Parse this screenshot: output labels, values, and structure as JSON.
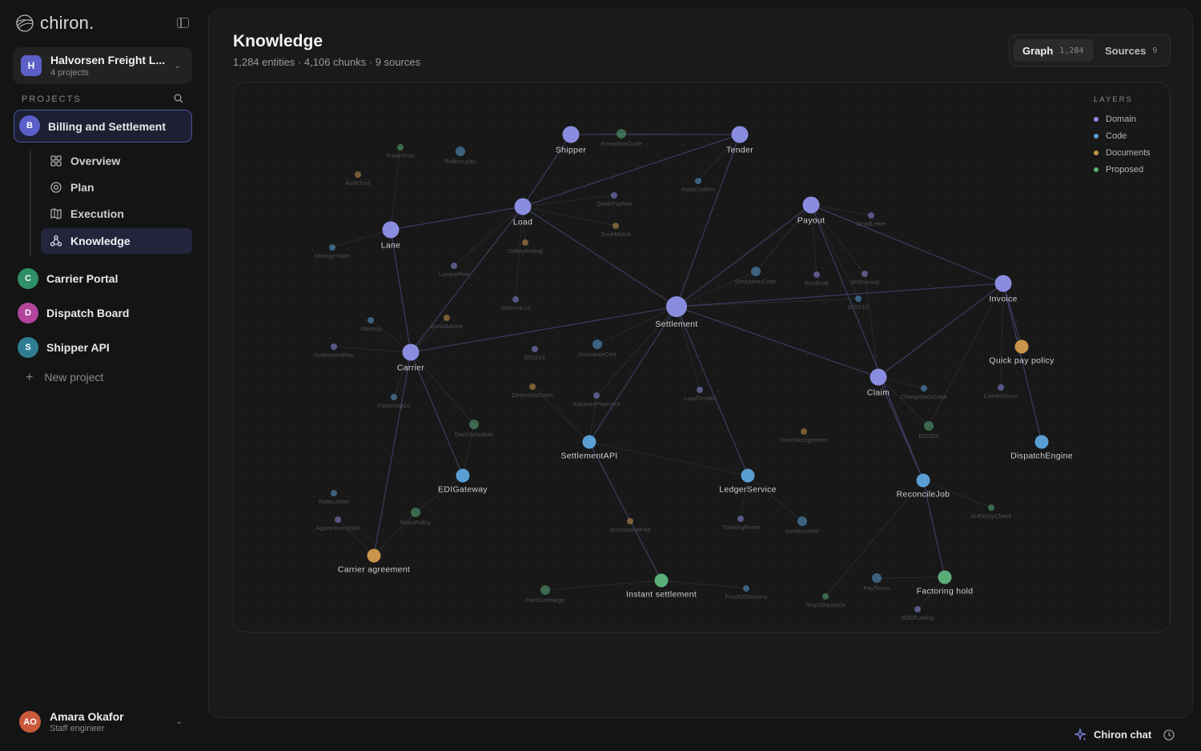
{
  "app": {
    "name": "chiron."
  },
  "workspace": {
    "avatar": "H",
    "name": "Halvorsen Freight L...",
    "sub": "4 projects"
  },
  "projects": {
    "label": "PROJECTS",
    "active": {
      "avatar": "B",
      "name": "Billing and Settlement"
    },
    "nav": [
      {
        "label": "Overview",
        "icon": "grid-icon"
      },
      {
        "label": "Plan",
        "icon": "target-icon"
      },
      {
        "label": "Execution",
        "icon": "map-icon"
      },
      {
        "label": "Knowledge",
        "icon": "graph-icon"
      }
    ],
    "others": [
      {
        "avatar": "C",
        "name": "Carrier Portal",
        "color": "#2f8f67"
      },
      {
        "avatar": "D",
        "name": "Dispatch Board",
        "color": "#b0459b"
      },
      {
        "avatar": "S",
        "name": "Shipper API",
        "color": "#2f7d93"
      }
    ],
    "new_label": "New project"
  },
  "user": {
    "initials": "AO",
    "name": "Amara Okafor",
    "role": "Staff engineer"
  },
  "header": {
    "title": "Knowledge",
    "subtitle": "1,284 entities · 4,106 chunks · 9 sources"
  },
  "tabs": [
    {
      "label": "Graph",
      "count": "1,284"
    },
    {
      "label": "Sources",
      "count": "9"
    }
  ],
  "legend": {
    "title": "LAYERS",
    "items": [
      {
        "label": "Domain",
        "color": "#8a8ddf"
      },
      {
        "label": "Code",
        "color": "#5a9fd4"
      },
      {
        "label": "Documents",
        "color": "#c9954a"
      },
      {
        "label": "Proposed",
        "color": "#5aac78"
      }
    ]
  },
  "graph": {
    "nodes": [
      {
        "label": "Shipper",
        "layer": "Domain",
        "major": true
      },
      {
        "label": "Tender",
        "layer": "Domain",
        "major": true
      },
      {
        "label": "Load",
        "layer": "Domain",
        "major": true
      },
      {
        "label": "Lane",
        "layer": "Domain",
        "major": true
      },
      {
        "label": "Payout",
        "layer": "Domain",
        "major": true
      },
      {
        "label": "Settlement",
        "layer": "Domain",
        "major": true
      },
      {
        "label": "Invoice",
        "layer": "Domain",
        "major": true
      },
      {
        "label": "Carrier",
        "layer": "Domain",
        "major": true
      },
      {
        "label": "Claim",
        "layer": "Domain",
        "major": true
      },
      {
        "label": "Quick pay policy",
        "layer": "Documents",
        "major": true
      },
      {
        "label": "SettlementAPI",
        "layer": "Code",
        "major": true
      },
      {
        "label": "DispatchEngine",
        "layer": "Code",
        "major": true
      },
      {
        "label": "EDIGateway",
        "layer": "Code",
        "major": true
      },
      {
        "label": "LedgerService",
        "layer": "Code",
        "major": true
      },
      {
        "label": "ReconcileJob",
        "layer": "Code",
        "major": true
      },
      {
        "label": "Carrier agreement",
        "layer": "Documents",
        "major": true
      },
      {
        "label": "Instant settlement",
        "layer": "Proposed",
        "major": true
      },
      {
        "label": "Factoring hold",
        "layer": "Proposed",
        "major": true
      },
      {
        "label": "ExceptionCode",
        "layer": "Proposed",
        "major": false
      },
      {
        "label": "TrailerPool",
        "layer": "Proposed",
        "major": false
      },
      {
        "label": "Rollout plan",
        "layer": "Code",
        "major": false
      },
      {
        "label": "AuditTrail",
        "layer": "Documents",
        "major": false
      },
      {
        "label": "RateConfirm",
        "layer": "Code",
        "major": false
      },
      {
        "label": "QuickPayFee",
        "layer": "Domain",
        "major": false
      },
      {
        "label": "ZoneMatrix",
        "layer": "Documents",
        "major": false
      },
      {
        "label": "DeadLetter",
        "layer": "Domain",
        "major": false
      },
      {
        "label": "SafetyRating",
        "layer": "Documents",
        "major": false
      },
      {
        "label": "MileageTable",
        "layer": "Code",
        "major": false
      },
      {
        "label": "LumperFee",
        "layer": "Domain",
        "major": false
      },
      {
        "label": "DeductionCode",
        "layer": "Code",
        "major": false
      },
      {
        "label": "Runbook",
        "layer": "Domain",
        "major": false
      },
      {
        "label": "W9Record",
        "layer": "Domain",
        "major": false
      },
      {
        "label": "EDI210",
        "layer": "Code",
        "major": false
      },
      {
        "label": "Schema v2",
        "layer": "Domain",
        "major": false
      },
      {
        "label": "Alerting",
        "layer": "Code",
        "major": false
      },
      {
        "label": "BondAdvice",
        "layer": "Documents",
        "major": false
      },
      {
        "label": "SettlementRun",
        "layer": "Domain",
        "major": false
      },
      {
        "label": "EDI214",
        "layer": "Domain",
        "major": false
      },
      {
        "label": "InsuranceCert",
        "layer": "Code",
        "major": false
      },
      {
        "label": "DetentionClaim",
        "layer": "Documents",
        "major": false
      },
      {
        "label": "AdvancePayment",
        "layer": "Domain",
        "major": false
      },
      {
        "label": "LoadTender",
        "layer": "Domain",
        "major": false
      },
      {
        "label": "ChargebackCase",
        "layer": "Code",
        "major": false
      },
      {
        "label": "CarrierScore",
        "layer": "Domain",
        "major": false
      },
      {
        "label": "FactoringCo",
        "layer": "Code",
        "major": false
      },
      {
        "label": "DockSchedule",
        "layer": "Proposed",
        "major": false
      },
      {
        "label": "DriverAssignment",
        "layer": "Documents",
        "major": false
      },
      {
        "label": "EDI204",
        "layer": "Proposed",
        "major": false
      },
      {
        "label": "RateLimiter",
        "layer": "Code",
        "major": false
      },
      {
        "label": "RetryPolicy",
        "layer": "Proposed",
        "major": false
      },
      {
        "label": "AppointmentSlot",
        "layer": "Domain",
        "major": false
      },
      {
        "label": "AccessorialFee",
        "layer": "Documents",
        "major": false
      },
      {
        "label": "TrackingEvent",
        "layer": "Domain",
        "major": false
      },
      {
        "label": "GeofenceHit",
        "layer": "Code",
        "major": false
      },
      {
        "label": "AuthorityCheck",
        "layer": "Proposed",
        "major": false
      },
      {
        "label": "FuelSurcharge",
        "layer": "Proposed",
        "major": false
      },
      {
        "label": "ProofOfDelivery",
        "layer": "Code",
        "major": false
      },
      {
        "label": "PayTerms",
        "layer": "Code",
        "major": false
      },
      {
        "label": "StopSequence",
        "layer": "Proposed",
        "major": false
      },
      {
        "label": "BillOfLading",
        "layer": "Domain",
        "major": false
      }
    ],
    "edges": [
      [
        "Shipper",
        "Tender"
      ],
      [
        "Shipper",
        "Load"
      ],
      [
        "Tender",
        "Load"
      ],
      [
        "Tender",
        "Settlement"
      ],
      [
        "Load",
        "Lane"
      ],
      [
        "Load",
        "Settlement"
      ],
      [
        "Load",
        "Carrier"
      ],
      [
        "Lane",
        "Carrier"
      ],
      [
        "Payout",
        "Settlement"
      ],
      [
        "Payout",
        "Invoice"
      ],
      [
        "Settlement",
        "Invoice"
      ],
      [
        "Settlement",
        "Carrier"
      ],
      [
        "Settlement",
        "Claim"
      ],
      [
        "Invoice",
        "Claim"
      ],
      [
        "Settlement",
        "SettlementAPI"
      ],
      [
        "Settlement",
        "LedgerService"
      ],
      [
        "Claim",
        "ReconcileJob"
      ],
      [
        "Invoice",
        "DispatchEngine"
      ],
      [
        "Carrier",
        "Carrier agreement"
      ],
      [
        "SettlementAPI",
        "Instant settlement"
      ],
      [
        "ReconcileJob",
        "Factoring hold"
      ],
      [
        "Invoice",
        "Quick pay policy"
      ],
      [
        "Carrier",
        "EDIGateway"
      ],
      [
        "Payout",
        "ReconcileJob"
      ]
    ]
  },
  "chat": {
    "label": "Chiron chat"
  }
}
